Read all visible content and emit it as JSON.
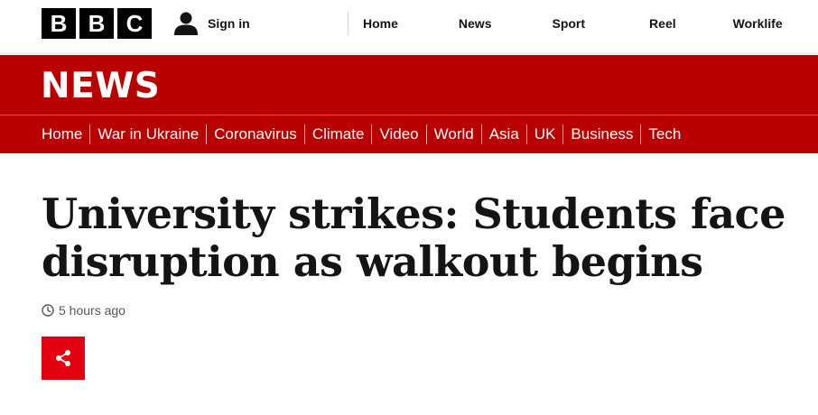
{
  "masthead": {
    "logo_letters": [
      "B",
      "B",
      "C"
    ],
    "signin_label": "Sign in",
    "signin_icon": "user-icon",
    "nav": [
      "Home",
      "News",
      "Sport",
      "Reel",
      "Worklife"
    ]
  },
  "banner": {
    "title": "NEWS",
    "color": "#b80000"
  },
  "section_nav": [
    "Home",
    "War in Ukraine",
    "Coronavirus",
    "Climate",
    "Video",
    "World",
    "Asia",
    "UK",
    "Business",
    "Tech"
  ],
  "article": {
    "headline": "University strikes: Students face disruption as walkout begins",
    "timestamp": "5 hours ago",
    "timestamp_icon": "clock-icon",
    "share_icon": "share-icon",
    "share_color": "#e3000f"
  }
}
